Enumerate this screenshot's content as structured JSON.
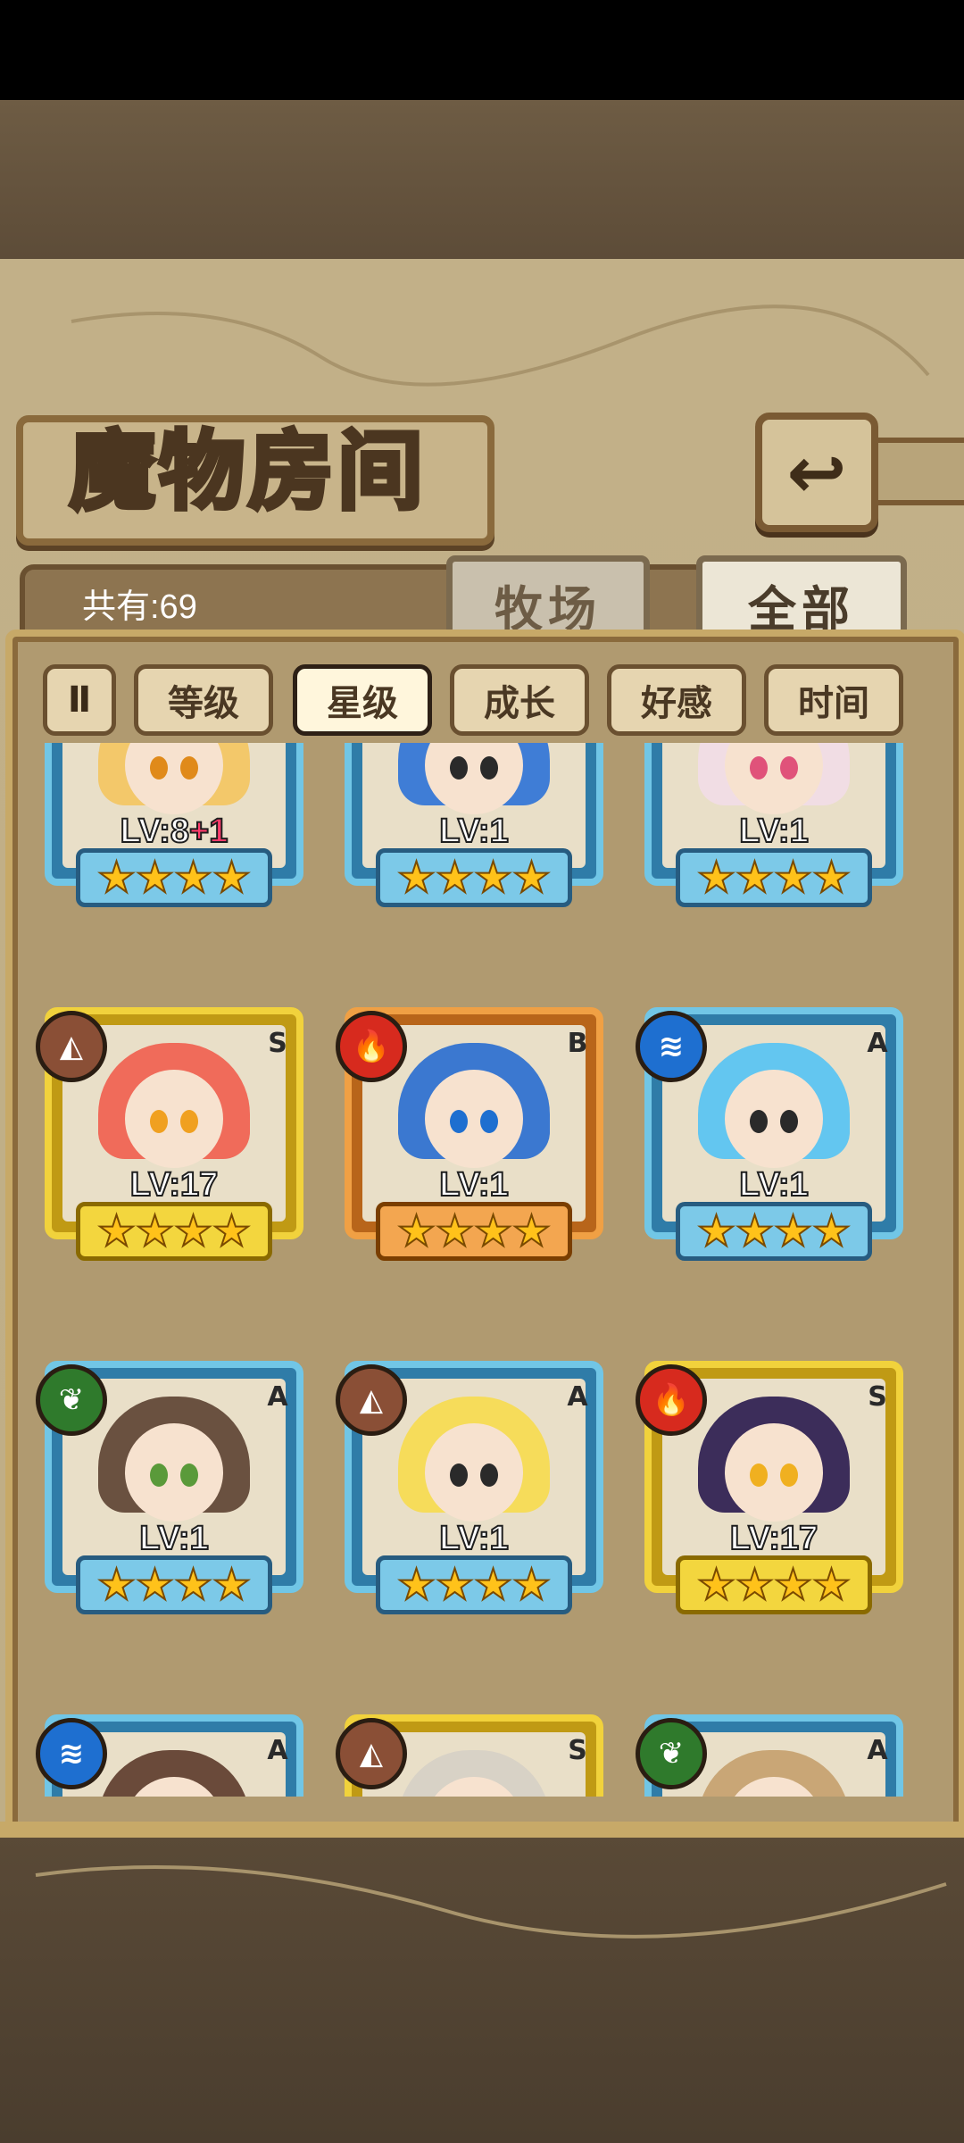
{
  "header": {
    "title": "魔物房间",
    "back_icon": "back-arrow-icon"
  },
  "counts": {
    "label": "共有:69"
  },
  "tabs": [
    {
      "label": "牧场"
    },
    {
      "label": "全部"
    }
  ],
  "sort": {
    "toggle_label": "Ⅱ",
    "buttons": [
      {
        "label": "等级",
        "active": false
      },
      {
        "label": "星级",
        "active": true
      },
      {
        "label": "成长",
        "active": false
      },
      {
        "label": "好感",
        "active": false
      },
      {
        "label": "时间",
        "active": false
      }
    ]
  },
  "cards": [
    {
      "frame": "blue",
      "element": "",
      "rank": "",
      "level": "LV:8",
      "bonus": "+1",
      "stars": "★★★★",
      "hair": "#f3c86a",
      "eye": "#e08a1a"
    },
    {
      "frame": "blue",
      "element": "",
      "rank": "",
      "level": "LV:1",
      "bonus": "",
      "stars": "★★★★",
      "hair": "#3f7dd6",
      "eye": "#2a2a2a"
    },
    {
      "frame": "blue",
      "element": "",
      "rank": "",
      "level": "LV:1",
      "bonus": "",
      "stars": "★★★★",
      "hair": "#f1dde4",
      "eye": "#e0527a"
    },
    {
      "frame": "gold",
      "element": "earth",
      "rank": "S",
      "level": "LV:17",
      "bonus": "",
      "stars": "★★★★",
      "hair": "#f06b5a",
      "eye": "#f0a020"
    },
    {
      "frame": "orange",
      "element": "fire",
      "rank": "B",
      "level": "LV:1",
      "bonus": "",
      "stars": "★★★★",
      "hair": "#3b78d0",
      "eye": "#1e6fd0"
    },
    {
      "frame": "blue",
      "element": "water",
      "rank": "A",
      "level": "LV:1",
      "bonus": "",
      "stars": "★★★★",
      "hair": "#63c6f0",
      "eye": "#2a2a2a"
    },
    {
      "frame": "blue",
      "element": "leaf",
      "rank": "A",
      "level": "LV:1",
      "bonus": "",
      "stars": "★★★★",
      "hair": "#6a5140",
      "eye": "#5a9a3a"
    },
    {
      "frame": "blue",
      "element": "earth",
      "rank": "A",
      "level": "LV:1",
      "bonus": "",
      "stars": "★★★★",
      "hair": "#f6dc5a",
      "eye": "#2a2a2a"
    },
    {
      "frame": "gold",
      "element": "fire",
      "rank": "S",
      "level": "LV:17",
      "bonus": "",
      "stars": "★★★★",
      "hair": "#3c2d5a",
      "eye": "#f0b020"
    },
    {
      "frame": "blue",
      "element": "water",
      "rank": "A",
      "level": "",
      "bonus": "",
      "stars": "",
      "hair": "#6a4a3a",
      "eye": "#2a2a2a"
    },
    {
      "frame": "gold",
      "element": "earth",
      "rank": "S",
      "level": "",
      "bonus": "",
      "stars": "",
      "hair": "#d8d2c6",
      "eye": "#2a2a2a"
    },
    {
      "frame": "blue",
      "element": "leaf",
      "rank": "A",
      "level": "",
      "bonus": "",
      "stars": "",
      "hair": "#c9a676",
      "eye": "#2a2a2a"
    }
  ],
  "colors": {
    "panel": "#b09a70",
    "frame_blue": "#71c6e6",
    "frame_gold": "#f1d23c",
    "frame_orange": "#f0a044",
    "star": "#ffc21a"
  }
}
